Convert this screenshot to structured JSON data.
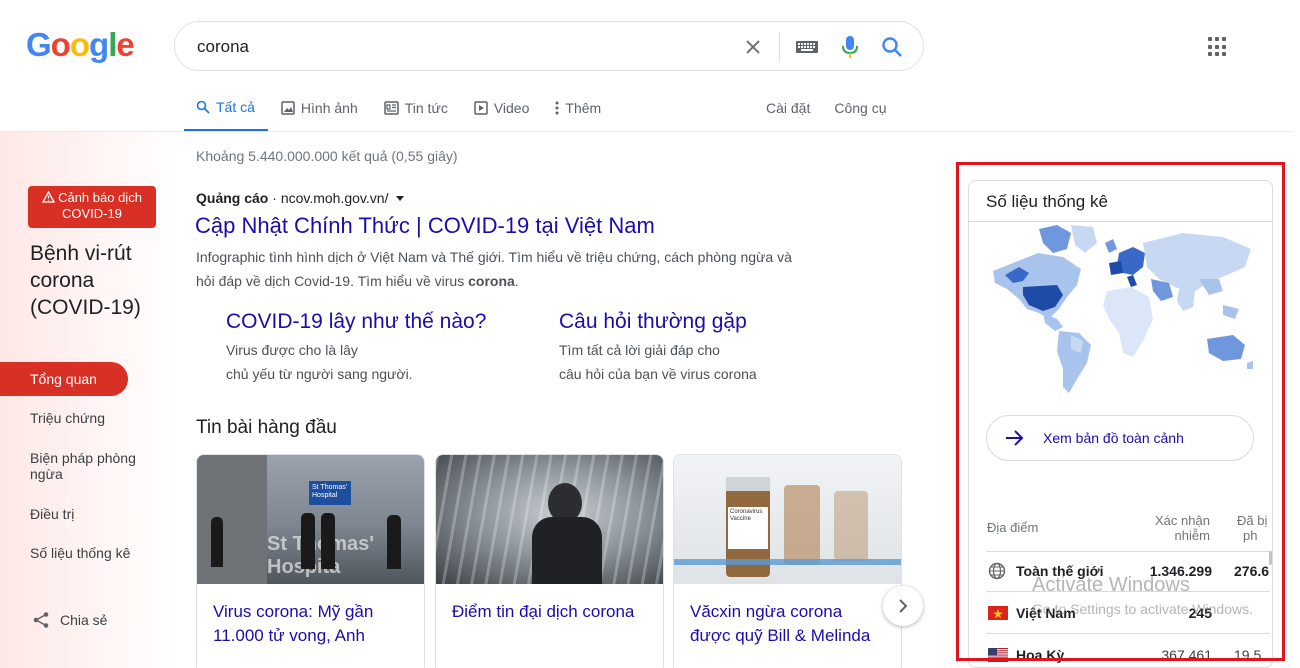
{
  "header": {
    "logo": "Google",
    "search_query": "corona",
    "colors": {
      "blue": "#4285f4",
      "red": "#ea4335",
      "yellow": "#fbbc05",
      "green": "#34a853"
    }
  },
  "tabs": {
    "items": [
      {
        "label": "Tất cả",
        "icon": "search-icon"
      },
      {
        "label": "Hình ảnh",
        "icon": "image-icon"
      },
      {
        "label": "Tin tức",
        "icon": "news-icon"
      },
      {
        "label": "Video",
        "icon": "video-icon"
      },
      {
        "label": "Thêm",
        "icon": "more-icon"
      }
    ],
    "settings": "Cài đặt",
    "tools": "Công cụ"
  },
  "sidebar": {
    "alert": "Cảnh báo dịch COVID-19",
    "title": "Bệnh vi-rút corona (COVID-19)",
    "items": [
      "Tổng quan",
      "Triệu chứng",
      "Biện pháp phòng ngừa",
      "Điều trị",
      "Số liệu thống kê"
    ],
    "share": "Chia sẻ"
  },
  "results": {
    "stats": "Khoảng 5.440.000.000 kết quả (0,55 giây)",
    "ad_label": "Quảng cáo",
    "ad_url": "ncov.moh.gov.vn/",
    "ad_title": "Cập Nhật Chính Thức | COVID-19 tại Việt Nam",
    "ad_desc_1": "Infographic tình hình dịch ở Việt Nam và Thế giới. Tìm hiểu về triệu chứng, cách phòng ngừa và",
    "ad_desc_2a": "hỏi đáp về dịch Covid-19. Tìm hiểu về virus ",
    "ad_desc_2b": "corona",
    "ad_desc_2c": ".",
    "sitelinks": [
      {
        "title": "COVID-19 lây như thế nào?",
        "line1": "Virus được cho là lây",
        "line2": "chủ yếu từ người sang người."
      },
      {
        "title": "Câu hỏi thường gặp",
        "line1": "Tìm tất cả lời giải đáp cho",
        "line2": "câu hỏi của bạn về virus corona"
      }
    ],
    "top_stories_heading": "Tin bài hàng đầu",
    "stories": [
      {
        "title": "Virus corona: Mỹ gần 11.000 tử vong, Anh",
        "image_text": "St Thomas' Hospital"
      },
      {
        "title": "Điểm tin đại dịch corona",
        "image_text": ""
      },
      {
        "title": "Văcxin ngừa corona được quỹ Bill & Melinda",
        "image_text": "Coronavirus Vaccine"
      }
    ]
  },
  "stats_panel": {
    "title": "Số liệu thống kê",
    "map_button": "Xem bản đồ toàn cảnh",
    "col_location": "Địa điểm",
    "col_confirmed_1": "Xác nhận",
    "col_confirmed_2": "nhiễm",
    "col_died_1": "Đã bị",
    "col_died_2": "ph",
    "rows": [
      {
        "name": "Toàn thế giới",
        "confirmed": "1.346.299",
        "died": "276.6",
        "icon": "globe-icon"
      },
      {
        "name": "Việt Nam",
        "confirmed": "245",
        "died": "",
        "icon": "vietnam-flag-icon"
      },
      {
        "name": "Hoa Kỳ",
        "confirmed": "367.461",
        "died": "19.5",
        "icon": "us-flag-icon"
      }
    ]
  },
  "watermark": {
    "line1": "Activate Windows",
    "line2": "Go to Settings to activate Windows."
  }
}
